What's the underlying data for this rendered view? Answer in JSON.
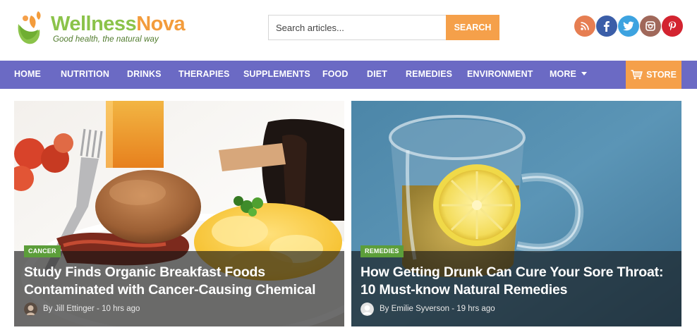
{
  "brand": {
    "name_part1": "Wellness",
    "name_part2": "Nova",
    "tagline": "Good health, the natural way",
    "colors": {
      "green": "#8bc34a",
      "orange": "#f39c3c",
      "leaf_green": "#5c9e3a"
    }
  },
  "search": {
    "placeholder": "Search articles...",
    "button_label": "SEARCH",
    "button_color": "#f5a04a"
  },
  "social": [
    {
      "name": "rss-icon",
      "color": "#e67e52"
    },
    {
      "name": "facebook-icon",
      "color": "#3b5ea8"
    },
    {
      "name": "twitter-icon",
      "color": "#3da3e0"
    },
    {
      "name": "instagram-icon",
      "color": "#a0685a"
    },
    {
      "name": "pinterest-icon",
      "color": "#d32430"
    }
  ],
  "nav": {
    "background": "#6b6ac4",
    "items": [
      {
        "label": "HOME"
      },
      {
        "label": "NUTRITION"
      },
      {
        "label": "DRINKS"
      },
      {
        "label": "THERAPIES"
      },
      {
        "label": "SUPPLEMENTS"
      },
      {
        "label": "FOOD"
      },
      {
        "label": "DIET"
      },
      {
        "label": "REMEDIES"
      },
      {
        "label": "ENVIRONMENT"
      },
      {
        "label": "MORE",
        "dropdown": true
      }
    ],
    "store": {
      "label": "STORE",
      "icon": "cart-icon",
      "color": "#f5a04a"
    }
  },
  "articles": [
    {
      "category": "CANCER",
      "title": "Study Finds Organic Breakfast Foods Contaminated with Cancer-Causing Chemical",
      "author_line": "By Jill Ettinger - 10 hrs ago"
    },
    {
      "category": "REMEDIES",
      "title": "How Getting Drunk Can Cure Your Sore Throat: 10 Must-know Natural Remedies",
      "author_line": "By Emilie Syverson - 19 hrs ago"
    }
  ]
}
